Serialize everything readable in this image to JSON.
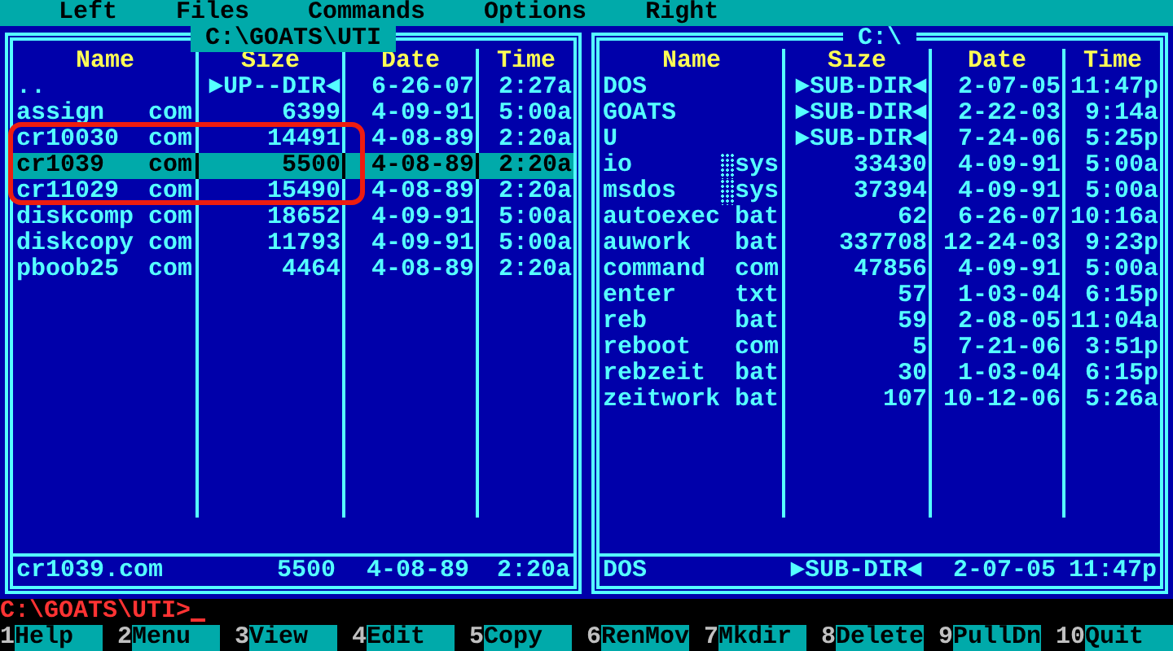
{
  "menu_bar": [
    "Left",
    "Files",
    "Commands",
    "Options",
    "Right"
  ],
  "panels": [
    {
      "path": "C:\\GOATS\\UTI",
      "active": true,
      "columns": [
        "Name",
        "Size",
        "Date",
        "Time"
      ],
      "files": [
        {
          "kind": "updir",
          "name": "..",
          "size": "►UP--DIR◄",
          "date": "6-26-07",
          "time": "2:27a",
          "selected": false
        },
        {
          "kind": "file",
          "name": "assign",
          "ext": "com",
          "size": "6399",
          "date": "4-09-91",
          "time": "5:00a",
          "selected": false
        },
        {
          "kind": "file",
          "name": "cr10030",
          "ext": "com",
          "size": "14491",
          "date": "4-08-89",
          "time": "2:20a",
          "selected": false
        },
        {
          "kind": "file",
          "name": "cr1039",
          "ext": "com",
          "size": "5500",
          "date": "4-08-89",
          "time": "2:20a",
          "selected": true
        },
        {
          "kind": "file",
          "name": "cr11029",
          "ext": "com",
          "size": "15490",
          "date": "4-08-89",
          "time": "2:20a",
          "selected": false
        },
        {
          "kind": "file",
          "name": "diskcomp",
          "ext": "com",
          "size": "18652",
          "date": "4-09-91",
          "time": "5:00a",
          "selected": false
        },
        {
          "kind": "file",
          "name": "diskcopy",
          "ext": "com",
          "size": "11793",
          "date": "4-09-91",
          "time": "5:00a",
          "selected": false
        },
        {
          "kind": "file",
          "name": "pboob25",
          "ext": "com",
          "size": "4464",
          "date": "4-08-89",
          "time": "2:20a",
          "selected": false
        }
      ],
      "status": {
        "name": "cr1039.com",
        "size": "5500",
        "date": "4-08-89",
        "time": "2:20a"
      }
    },
    {
      "path": "C:\\",
      "active": false,
      "columns": [
        "Name",
        "Size",
        "Date",
        "Time"
      ],
      "files": [
        {
          "kind": "dir",
          "name": "DOS",
          "size": "►SUB-DIR◄",
          "date": "2-07-05",
          "time": "11:47p",
          "selected": false
        },
        {
          "kind": "dir",
          "name": "GOATS",
          "size": "►SUB-DIR◄",
          "date": "2-22-03",
          "time": "9:14a",
          "selected": false
        },
        {
          "kind": "dir",
          "name": "U",
          "size": "►SUB-DIR◄",
          "date": "7-24-06",
          "time": "5:25p",
          "selected": false
        },
        {
          "kind": "system",
          "name": "io",
          "ext": "sys",
          "size": "33430",
          "date": "4-09-91",
          "time": "5:00a",
          "selected": false
        },
        {
          "kind": "system",
          "name": "msdos",
          "ext": "sys",
          "size": "37394",
          "date": "4-09-91",
          "time": "5:00a",
          "selected": false
        },
        {
          "kind": "file",
          "name": "autoexec",
          "ext": "bat",
          "size": "62",
          "date": "6-26-07",
          "time": "10:16a",
          "selected": false
        },
        {
          "kind": "file",
          "name": "auwork",
          "ext": "bat",
          "size": "337708",
          "date": "12-24-03",
          "time": "9:23p",
          "selected": false
        },
        {
          "kind": "file",
          "name": "command",
          "ext": "com",
          "size": "47856",
          "date": "4-09-91",
          "time": "5:00a",
          "selected": false
        },
        {
          "kind": "file",
          "name": "enter",
          "ext": "txt",
          "size": "57",
          "date": "1-03-04",
          "time": "6:15p",
          "selected": false
        },
        {
          "kind": "file",
          "name": "reb",
          "ext": "bat",
          "size": "59",
          "date": "2-08-05",
          "time": "11:04a",
          "selected": false
        },
        {
          "kind": "file",
          "name": "reboot",
          "ext": "com",
          "size": "5",
          "date": "7-21-06",
          "time": "3:51p",
          "selected": false
        },
        {
          "kind": "file",
          "name": "rebzeit",
          "ext": "bat",
          "size": "30",
          "date": "1-03-04",
          "time": "6:15p",
          "selected": false
        },
        {
          "kind": "file",
          "name": "zeitwork",
          "ext": "bat",
          "size": "107",
          "date": "10-12-06",
          "time": "5:26a",
          "selected": false
        }
      ],
      "status": {
        "name": "DOS",
        "size": "►SUB-DIR◄",
        "date": "2-07-05",
        "time": "11:47p"
      }
    }
  ],
  "command_line": {
    "prompt": "C:\\GOATS\\UTI>"
  },
  "function_keys": [
    {
      "number": "1",
      "label": "Help"
    },
    {
      "number": "2",
      "label": "Menu"
    },
    {
      "number": "3",
      "label": "View"
    },
    {
      "number": "4",
      "label": "Edit"
    },
    {
      "number": "5",
      "label": "Copy"
    },
    {
      "number": "6",
      "label": "RenMov"
    },
    {
      "number": "7",
      "label": "Mkdir"
    },
    {
      "number": "8",
      "label": "Delete"
    },
    {
      "number": "9",
      "label": "PullDn"
    },
    {
      "number": "10",
      "label": "Quit"
    }
  ]
}
